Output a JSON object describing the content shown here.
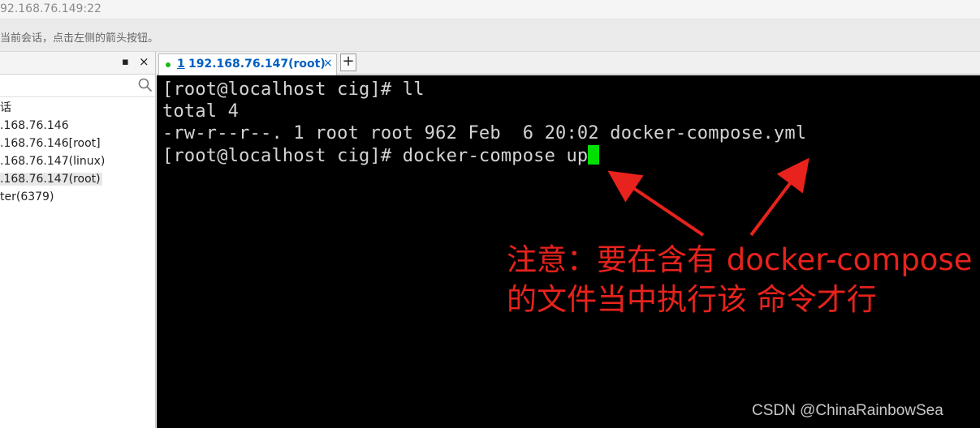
{
  "window": {
    "title": "92.168.76.149:22"
  },
  "infobar": {
    "text": "当前会话，点击左侧的箭头按钮。"
  },
  "session_panel": {
    "pin_glyph": "▪",
    "close_glyph": "×",
    "search_placeholder": "",
    "items": [
      {
        "label": "话"
      },
      {
        "label": ".168.76.146"
      },
      {
        "label": ".168.76.146[root]"
      },
      {
        "label": ".168.76.147(linux)"
      },
      {
        "label": ".168.76.147(root)",
        "selected": true
      },
      {
        "label": "ter(6379)"
      }
    ]
  },
  "tabs": {
    "active": {
      "index": "1",
      "label": "192.168.76.147(root)",
      "close_glyph": "×"
    },
    "new_tab_glyph": "+"
  },
  "terminal": {
    "lines": [
      "[root@localhost cig]# ll",
      "total 4",
      "-rw-r--r--. 1 root root 962 Feb  6 20:02 docker-compose.yml",
      "[root@localhost cig]# docker-compose up"
    ],
    "cursor_color": "#00e000"
  },
  "annotation": {
    "line1": "注意：要在含有 docker-compose",
    "line2": "的文件当中执行该 命令才行",
    "color": "#e8221c"
  },
  "watermark": {
    "text": "CSDN @ChinaRainbowSea"
  },
  "colors": {
    "accent": "#0060c0",
    "status_dot": "#19b919",
    "terminal_bg": "#000000"
  }
}
